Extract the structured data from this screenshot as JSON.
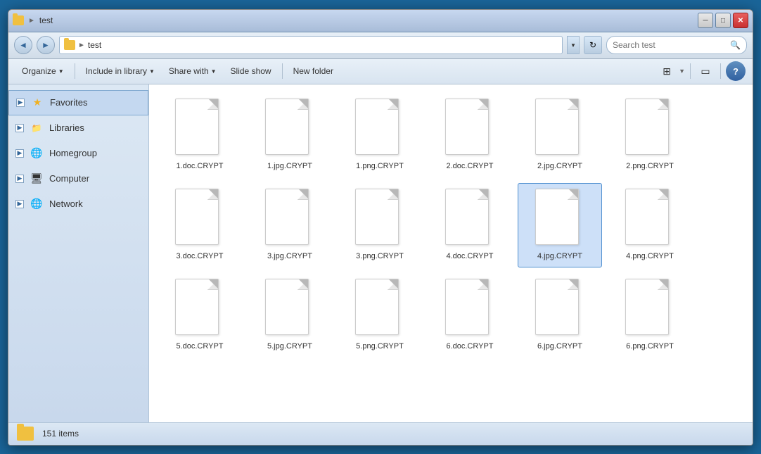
{
  "window": {
    "title": "test",
    "controls": {
      "minimize": "─",
      "maximize": "□",
      "close": "✕"
    }
  },
  "address_bar": {
    "back_arrow": "◄",
    "forward_arrow": "►",
    "folder_name": "test",
    "dropdown_arrow": "▼",
    "refresh": "↻",
    "search_placeholder": "Search test"
  },
  "toolbar": {
    "organize": "Organize",
    "include_in_library": "Include in library",
    "share_with": "Share with",
    "slide_show": "Slide show",
    "new_folder": "New folder",
    "dropdown": "▼",
    "help": "?"
  },
  "sidebar": {
    "items": [
      {
        "id": "favorites",
        "label": "Favorites",
        "has_expand": true,
        "selected": true,
        "icon": "star"
      },
      {
        "id": "libraries",
        "label": "Libraries",
        "has_expand": true,
        "selected": false,
        "icon": "folder"
      },
      {
        "id": "homegroup",
        "label": "Homegroup",
        "has_expand": true,
        "selected": false,
        "icon": "globe"
      },
      {
        "id": "computer",
        "label": "Computer",
        "has_expand": true,
        "selected": false,
        "icon": "monitor"
      },
      {
        "id": "network",
        "label": "Network",
        "has_expand": true,
        "selected": false,
        "icon": "globe"
      }
    ]
  },
  "files": [
    {
      "name": "1.doc.CRYPT",
      "selected": false
    },
    {
      "name": "1.jpg.CRYPT",
      "selected": false
    },
    {
      "name": "1.png.CRYPT",
      "selected": false
    },
    {
      "name": "2.doc.CRYPT",
      "selected": false
    },
    {
      "name": "2.jpg.CRYPT",
      "selected": false
    },
    {
      "name": "2.png.CRYPT",
      "selected": false
    },
    {
      "name": "3.doc.CRYPT",
      "selected": false
    },
    {
      "name": "3.jpg.CRYPT",
      "selected": false
    },
    {
      "name": "3.png.CRYPT",
      "selected": false
    },
    {
      "name": "4.doc.CRYPT",
      "selected": false
    },
    {
      "name": "4.jpg.CRYPT",
      "selected": true
    },
    {
      "name": "4.png.CRYPT",
      "selected": false
    },
    {
      "name": "5.doc.CRYPT",
      "selected": false
    },
    {
      "name": "5.jpg.CRYPT",
      "selected": false
    },
    {
      "name": "5.png.CRYPT",
      "selected": false
    },
    {
      "name": "6.doc.CRYPT",
      "selected": false
    },
    {
      "name": "6.jpg.CRYPT",
      "selected": false
    },
    {
      "name": "6.png.CRYPT",
      "selected": false
    }
  ],
  "status_bar": {
    "item_count": "151 items"
  }
}
